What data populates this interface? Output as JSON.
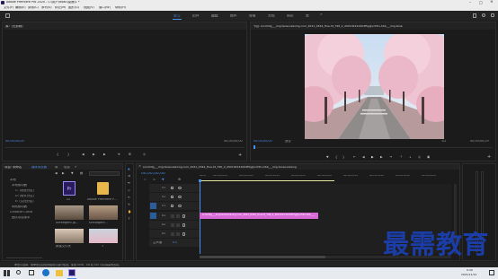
{
  "app": {
    "title": "Adobe Premiere Pro 2020 - C:\\用户\\ddau\\桌面\\1 *",
    "window_controls": {
      "minimize": "–",
      "maximize": "□",
      "close": "×"
    }
  },
  "menu": [
    "文件(F)",
    "编辑(E)",
    "剪辑(C)",
    "序列(S)",
    "标记(M)",
    "图形(G)",
    "视图(V)",
    "窗口(W)",
    "帮助(H)"
  ],
  "workspaces": {
    "tabs": [
      "学习",
      "组件",
      "编辑",
      "颜色",
      "效果",
      "音频",
      "图形",
      "库"
    ],
    "active": "学习",
    "more": "»"
  },
  "source_monitor": {
    "tab_label": "源：(无剪辑)",
    "timecode_left": "00;00;00;00",
    "timecode_right": "00;00;00;00"
  },
  "program_monitor": {
    "tab_label": "节目: scrolldlg___img.tansouzaxing.com_2021_0344_Hua-ht_796_2_202102141004f5g@vcfdt+hbb___img.tansouzaxing",
    "timecode": "00;00;00;00",
    "fit": "适合",
    "quality": "1/2",
    "duration": "00;00;00;29"
  },
  "project_panel": {
    "tabs": [
      "项目: 未命名",
      "媒体浏览器",
      "库",
      "信息"
    ],
    "more": "»",
    "tree": [
      {
        "label": "本地",
        "level": 0
      },
      {
        "label": "本地驱动器",
        "level": 1
      },
      {
        "label": "C: (系统分区)",
        "level": 2
      },
      {
        "label": "D: (软件分区)",
        "level": 2
      },
      {
        "label": "E: (文档分区)",
        "level": 2
      },
      {
        "label": "网络驱动器",
        "level": 1
      },
      {
        "label": "Creative Cloud",
        "level": 0
      },
      {
        "label": "团队项目版本",
        "level": 1
      }
    ],
    "thumbs": [
      {
        "label": "02",
        "kind": "pr"
      },
      {
        "label": "Adobe Premiere P...",
        "kind": "folder"
      },
      {
        "label": "Scene.png",
        "kind": "folder"
      },
      {
        "label": "scenegent.jp...",
        "kind": "photo"
      },
      {
        "label": "scenegent...",
        "kind": "photo"
      },
      {
        "label": "新建文件夹",
        "kind": "photo"
      },
      {
        "label": "1",
        "kind": "photo"
      }
    ]
  },
  "timeline": {
    "tab_label": "scrolldlg___img.tansouzaxing.com_2021_0344_Hua-ht_796_2_202102141004f5g@vcfdt+hbb___img.tansouzaxing",
    "timecode": "00;00;00;00",
    "ruler": [
      "00;00",
      "00;00;04;29",
      "00;00;09;29",
      "00;00;14;29",
      "00;00;19;29",
      "00;00;24;29",
      "00;00;29;29",
      "00;00;34;28",
      "00;00;39;28",
      "00;00;44;28"
    ],
    "tracks": [
      {
        "name": "V3",
        "type": "video"
      },
      {
        "name": "V2",
        "type": "video"
      },
      {
        "name": "V1",
        "type": "video"
      },
      {
        "name": "A1",
        "type": "audio"
      },
      {
        "name": "A2",
        "type": "audio"
      },
      {
        "name": "A3",
        "type": "audio"
      },
      {
        "name": "主声道",
        "type": "master",
        "value": "0.0"
      }
    ],
    "clip_label": "scrolldlg___img.tansouzaxing.com_2021_0344_Hua-ht_796_2_202102141004f5g@vcfdt+hbb___"
  },
  "status_bar": "单击以选择，或单击空白处并拖动以进行框选。使用 Shift、Alt 和 Ctrl 可获得其他选项。",
  "watermark": "最需教育",
  "taskbar": {
    "time": "9:49",
    "date": "2021/11/12",
    "search_placeholder": "在这里输入你要搜索的内容"
  },
  "colors": {
    "accent_blue": "#4a8fe8",
    "clip_pink": "#d86ad8",
    "watermark_blue": "#1a3da8"
  }
}
